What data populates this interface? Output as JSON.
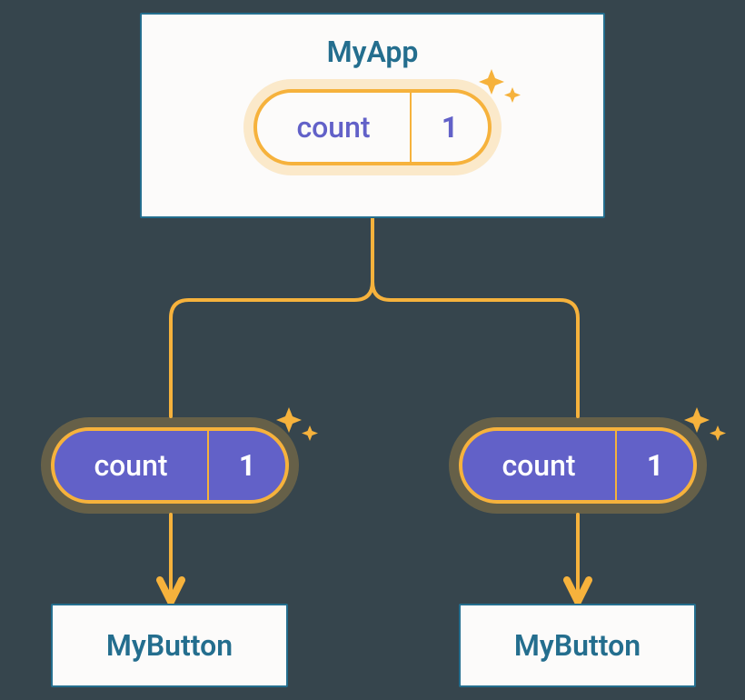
{
  "parent": {
    "title": "MyApp",
    "state_label": "count",
    "state_value": "1"
  },
  "children": [
    {
      "prop_label": "count",
      "prop_value": "1",
      "box_label": "MyButton"
    },
    {
      "prop_label": "count",
      "prop_value": "1",
      "box_label": "MyButton"
    }
  ],
  "colors": {
    "outline": "#246e8e",
    "pill_border": "#f6b23c",
    "pill_solid": "#6261c8",
    "bg": "#36454d",
    "card_bg": "#fcfbfa"
  }
}
